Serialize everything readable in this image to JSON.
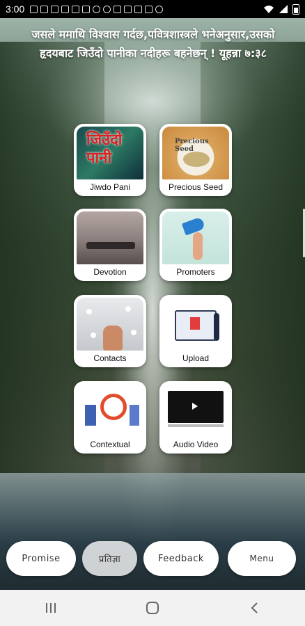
{
  "status_bar": {
    "time": "3:00"
  },
  "verse": "जसले ममाथि विश्वास गर्दछ,पवित्रशास्त्रले भनेअनुसार,उसको हृदयबाट जिउँदो पानीका नदीहरू बहनेछन् ! यूहन्ना ७:३८",
  "tiles": [
    {
      "label": "Jiwdo Pani",
      "image_text": "जिउँदो पानी"
    },
    {
      "label": "Precious Seed",
      "image_text": "Precious Seed"
    },
    {
      "label": "Devotion"
    },
    {
      "label": "Promoters"
    },
    {
      "label": "Contacts"
    },
    {
      "label": "Upload"
    },
    {
      "label": "Contextual"
    },
    {
      "label": "Audio Video"
    }
  ],
  "bottom_buttons": {
    "promise": "Promise",
    "pratigya": "प्रतिज्ञा",
    "feedback": "Feedback",
    "menu": "Menu"
  },
  "icons": {
    "status": [
      "gmail-icon",
      "youtube-icon",
      "voicemail-icon",
      "warning-icon",
      "wifi-icon",
      "signal-icon",
      "battery-icon"
    ],
    "nav": [
      "recents-icon",
      "home-icon",
      "back-icon"
    ]
  }
}
